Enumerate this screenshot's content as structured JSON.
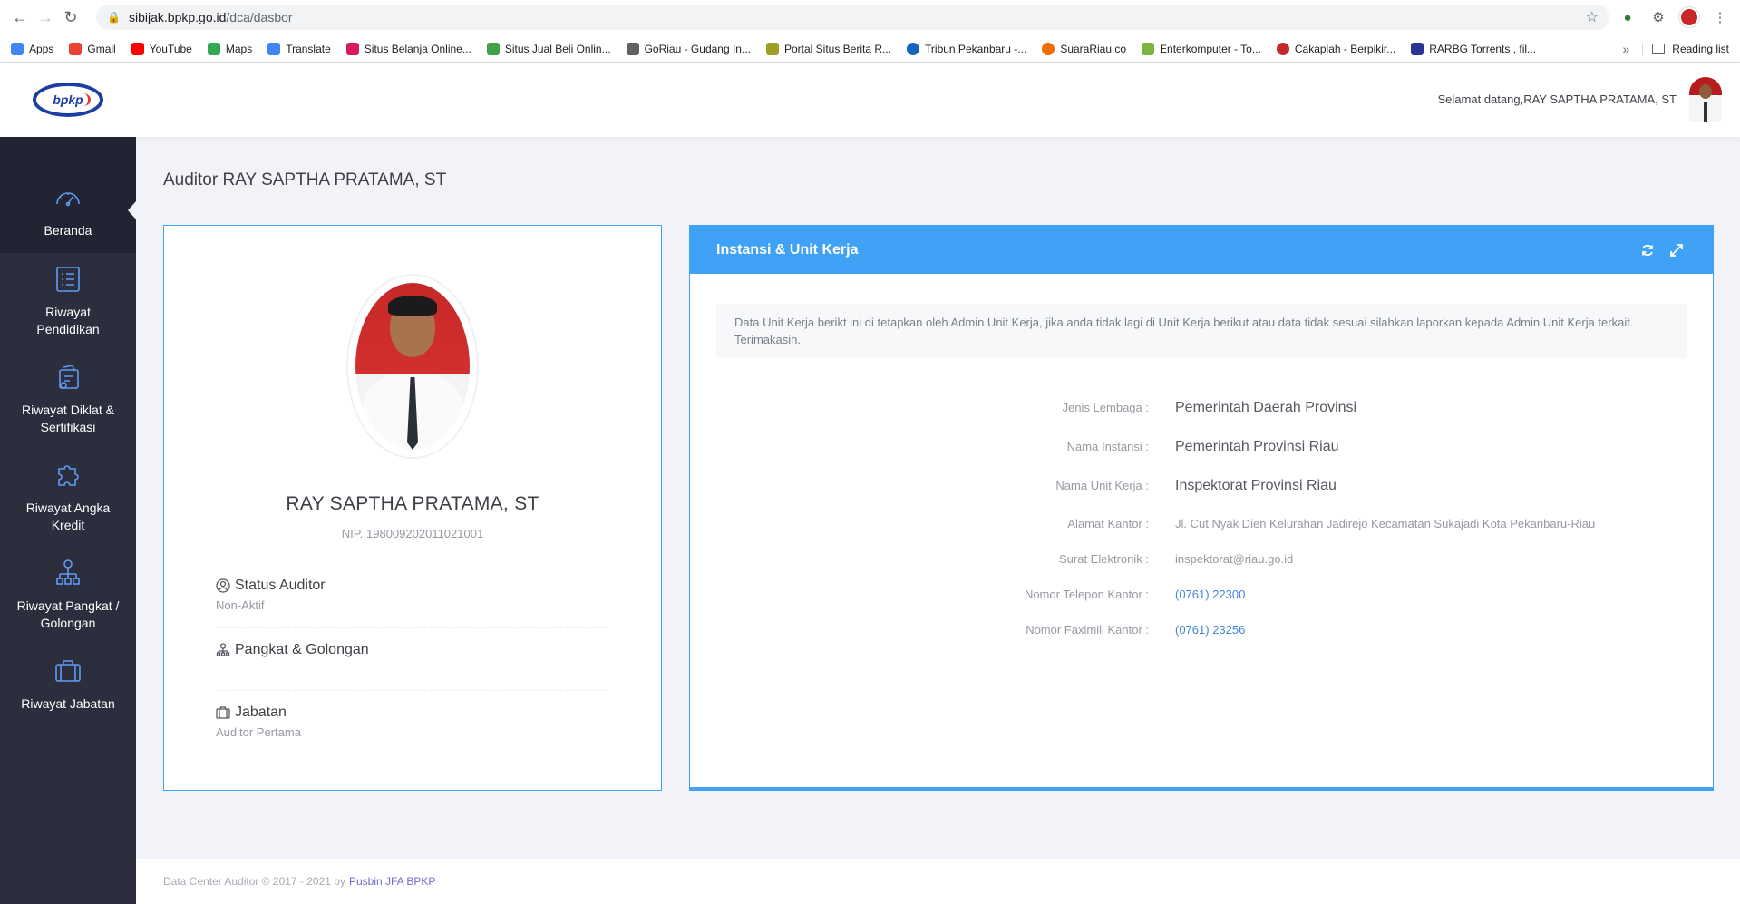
{
  "browser": {
    "url_host": "sibijak.bpkp.go.id",
    "url_path": "/dca/dasbor",
    "bookmarks": [
      {
        "label": "Apps",
        "color": "#4285f4"
      },
      {
        "label": "Gmail",
        "color": "#ea4335"
      },
      {
        "label": "YouTube",
        "color": "#ff0000"
      },
      {
        "label": "Maps",
        "color": "#34a853"
      },
      {
        "label": "Translate",
        "color": "#4285f4"
      },
      {
        "label": "Situs Belanja Online...",
        "color": "#d81b60"
      },
      {
        "label": "Situs Jual Beli Onlin...",
        "color": "#43a047"
      },
      {
        "label": "GoRiau - Gudang In...",
        "color": "#616161"
      },
      {
        "label": "Portal Situs Berita R...",
        "color": "#9e9d24"
      },
      {
        "label": "Tribun Pekanbaru -...",
        "color": "#1565c0"
      },
      {
        "label": "SuaraRiau.co",
        "color": "#ef6c00"
      },
      {
        "label": "Enterkomputer - To...",
        "color": "#7cb342"
      },
      {
        "label": "Cakaplah - Berpikir...",
        "color": "#c62828"
      },
      {
        "label": "RARBG Torrents , fil...",
        "color": "#283593"
      }
    ],
    "reading_list": "Reading list"
  },
  "header": {
    "logo_text": "bpkp",
    "welcome": "Selamat datang,RAY SAPTHA PRATAMA, ST"
  },
  "sidebar": {
    "items": [
      {
        "label": "Beranda",
        "icon": "speedometer-icon"
      },
      {
        "label": "Riwayat Pendidikan",
        "icon": "list-icon"
      },
      {
        "label": "Riwayat Diklat & Sertifikasi",
        "icon": "certificate-icon"
      },
      {
        "label": "Riwayat Angka Kredit",
        "icon": "puzzle-icon"
      },
      {
        "label": "Riwayat Pangkat / Golongan",
        "icon": "hierarchy-icon"
      },
      {
        "label": "Riwayat Jabatan",
        "icon": "briefcase-icon"
      }
    ]
  },
  "page_title": "Auditor RAY SAPTHA PRATAMA, ST",
  "profile": {
    "name": "RAY SAPTHA PRATAMA, ST",
    "nip": "NIP. 198009202011021001",
    "status_label": "Status Auditor",
    "status_value": "Non-Aktif",
    "pangkat_label": "Pangkat & Golongan",
    "pangkat_value": "",
    "jabatan_label": "Jabatan",
    "jabatan_value": "Auditor Pertama"
  },
  "unit": {
    "title": "Instansi & Unit Kerja",
    "notice": "Data Unit Kerja berikt ini di tetapkan oleh Admin Unit Kerja, jika anda tidak lagi di Unit Kerja berikut atau data tidak sesuai silahkan laporkan kepada Admin Unit Kerja terkait. Terimakasih.",
    "rows": [
      {
        "label": "Jenis Lembaga :",
        "value": "Pemerintah Daerah Provinsi"
      },
      {
        "label": "Nama Instansi :",
        "value": "Pemerintah Provinsi Riau"
      },
      {
        "label": "Nama Unit Kerja :",
        "value": "Inspektorat Provinsi Riau"
      },
      {
        "label": "Alamat Kantor :",
        "value": "Jl. Cut Nyak Dien Kelurahan Jadirejo Kecamatan Sukajadi Kota Pekanbaru-Riau"
      },
      {
        "label": "Surat Elektronik :",
        "value": "inspektorat@riau.go.id"
      },
      {
        "label": "Nomor Telepon Kantor :",
        "value": "(0761) 22300"
      },
      {
        "label": "Nomor Faximili Kantor :",
        "value": "(0761) 23256"
      }
    ]
  },
  "footer": {
    "text": "Data Center Auditor © 2017 - 2021 by",
    "link": "Pusbin JFA BPKP"
  }
}
